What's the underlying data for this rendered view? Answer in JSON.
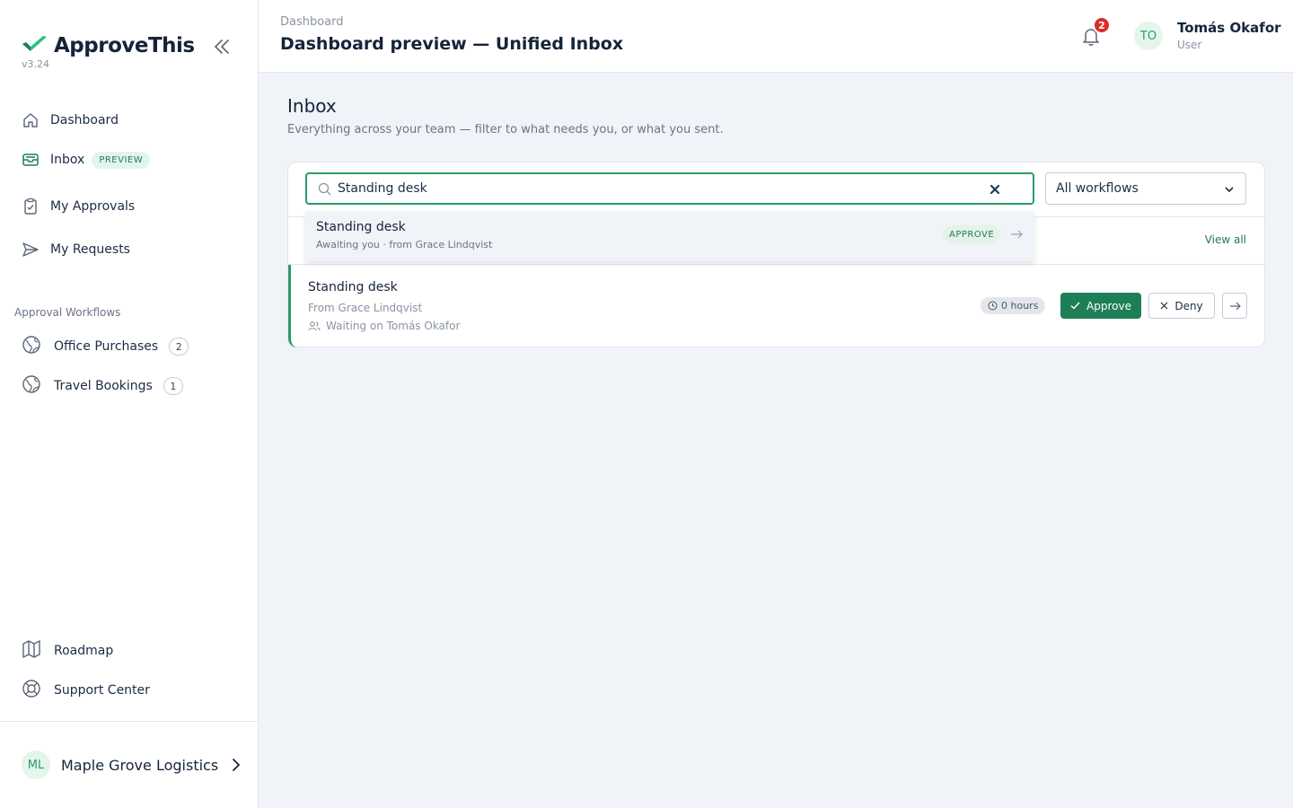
{
  "app": {
    "name": "ApproveThis",
    "version": "v3.24"
  },
  "sidebar": {
    "nav": [
      {
        "label": "Dashboard",
        "icon": "home-icon"
      },
      {
        "label": "Inbox",
        "icon": "inbox-icon",
        "badge": "PREVIEW"
      },
      {
        "label": "My Approvals",
        "icon": "clipboard-check-icon"
      },
      {
        "label": "My Requests",
        "icon": "send-icon"
      }
    ],
    "workflows_title": "Approval Workflows",
    "workflows": [
      {
        "label": "Office Purchases",
        "count": "2",
        "icon": "globe-icon"
      },
      {
        "label": "Travel Bookings",
        "count": "1",
        "icon": "globe-icon"
      }
    ],
    "bottom": [
      {
        "label": "Roadmap",
        "icon": "map-icon"
      },
      {
        "label": "Support Center",
        "icon": "lifebuoy-icon"
      }
    ],
    "org": {
      "initials": "ML",
      "name": "Maple Grove Logistics"
    }
  },
  "header": {
    "breadcrumb": "Dashboard",
    "title": "Dashboard preview — Unified Inbox",
    "notifications": "2",
    "user": {
      "initials": "TO",
      "name": "Tomás Okafor",
      "role": "User"
    }
  },
  "main": {
    "title": "Inbox",
    "subtitle": "Everything across your team — filter to what needs you, or what you sent.",
    "search": {
      "value": "Standing desk"
    },
    "filter": {
      "value": "All workflows"
    },
    "suggestion": {
      "title": "Standing desk",
      "subtitle": "Awaiting you · from Grace Lindqvist",
      "tag": "APPROVE"
    },
    "view_all": "View all",
    "request": {
      "title": "Standing desk",
      "from": "From Grace Lindqvist",
      "waiting": "Waiting on Tomás Okafor",
      "age": "0 hours",
      "approve_label": "Approve",
      "deny_label": "Deny"
    }
  },
  "colors": {
    "accent": "#1e7f57",
    "accent_light": "#e4f6ec",
    "danger": "#d92d2d",
    "background": "#f0f3f7"
  }
}
